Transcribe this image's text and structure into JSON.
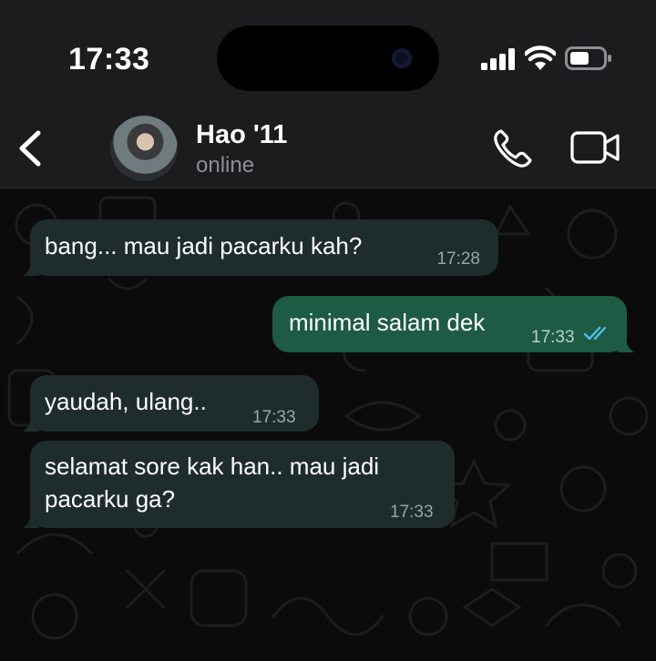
{
  "status_bar": {
    "time": "17:33"
  },
  "header": {
    "contact_name": "Hao '11",
    "contact_status": "online"
  },
  "colors": {
    "incoming_bubble": "#1f2c2c",
    "outgoing_bubble": "#1e5b44",
    "read_ticks": "#53bdeb",
    "background": "#0b0b0b"
  },
  "icons": [
    "back-chevron-icon",
    "phone-icon",
    "video-camera-icon",
    "signal-icon",
    "wifi-icon",
    "battery-icon",
    "double-check-icon"
  ],
  "messages": [
    {
      "direction": "incoming",
      "text": "bang... mau jadi pacarku kah?",
      "time": "17:28"
    },
    {
      "direction": "outgoing",
      "text": "minimal salam dek",
      "time": "17:33",
      "status": "read"
    },
    {
      "direction": "incoming",
      "text": "yaudah, ulang..",
      "time": "17:33"
    },
    {
      "direction": "incoming",
      "text_lines": [
        "selamat sore kak han.. mau jadi",
        "pacarku ga?"
      ],
      "time": "17:33"
    }
  ]
}
